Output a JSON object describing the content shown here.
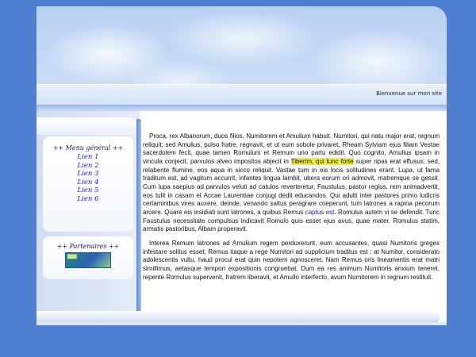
{
  "header": {
    "welcome_text": "Bienvenue sur mon site"
  },
  "sidebar": {
    "menu_title": "++ Menu général ++",
    "menu_items": [
      {
        "label": "Lien 1"
      },
      {
        "label": "Lien 2"
      },
      {
        "label": "Lien 3"
      },
      {
        "label": "Lien 4"
      },
      {
        "label": "Lien 5"
      },
      {
        "label": "Lien 6"
      }
    ],
    "partners_title": "++ Partenaires ++"
  },
  "content": {
    "p1_before": "Proca, rex Albanorum, duos filios, Numitorem et Amulium habuit. Numitori, qui natu major erat, regnum reliquit; sed Amulius, pulso fratre, regnavit, et ut eum sobole privaret, Rheam Sylviam ejus filiam Vestae sacerdotem fecit, quae tamen Romulum et Remum uno partu edidit. Quo cognito, Amulius ipsam in vincula conjecit, parvulos alveo impositos abjecit in ",
    "p1_highlight": "Tiberim, qui tunc forte",
    "p1_middle": " super ripas erat effusus; sed, relabente flumine, eos aqua in sicco reliquit. Vastae tum in eis locis solitudines erant. Lupa, ut fama traditum est, ad vagitum accurrit, infantes lingua lambit, ubera eorum ori admovit, matremque se gessit. Cum lupa saepius ad parvulos veluti ad catulos reverteretur, Faustulus, pastor regius, rem animadvertit, eos tulit in casam et Accae Laurentiae conjugi dedit educandos. Qui adulti inter pastores primo ludicris certaminibus vires auxere, deinde, venando saltus peragrare coeperunt, tum latrones a rapina pecorum arcere. Quare eis insidiati sunt latrones, a quibus Remus ",
    "p1_link": "captus est",
    "p1_after": ". Romulus autem vi se defendit. Tunc Faustulus necessitate compulsus indicavit Romulo quis esset ejus avus, quae mater. Romulus statim, armatis pastoribus, Albam properavit.",
    "p2": "Interea Remum latrones ad Amulium regem perduxerunt, eum accusantes, quasi Numitoris greges infestare solitus esset; Remus itaque a rege Numitori ad supplicium traditus est : at Numitor, considerato adolescentis vultu, haud procul erat quin nepotem agnosceret. Nam Remus oris lineamentis erat matri simillimus, aetasque tempori expositionis congruebat. Dum ea res animum Numitoris anxium teneret, repente Romulus supervenit, fratrem liberavit, et Amulio interfecto, avum Numitorem in regnum restituit."
  },
  "colors": {
    "page_background": "#4f7fd0",
    "link": "#1a1ad0",
    "highlight": "#f4ef3a"
  }
}
